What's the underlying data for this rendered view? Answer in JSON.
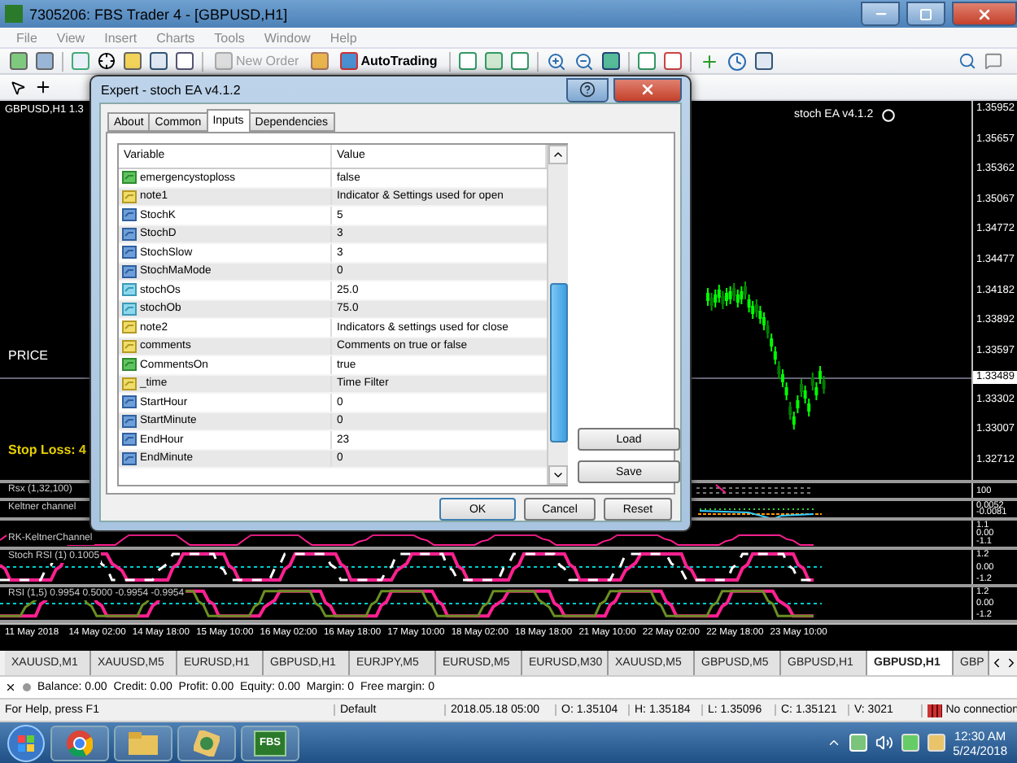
{
  "window": {
    "title": "7305206: FBS Trader 4 - [GBPUSD,H1]"
  },
  "menu": [
    {
      "label": "File",
      "disabled": true
    },
    {
      "label": "View",
      "disabled": true
    },
    {
      "label": "Insert",
      "disabled": true
    },
    {
      "label": "Charts",
      "disabled": true
    },
    {
      "label": "Tools",
      "disabled": true
    },
    {
      "label": "Window",
      "disabled": true
    },
    {
      "label": "Help",
      "disabled": true
    }
  ],
  "toolbar": {
    "new_order": {
      "label": "New Order",
      "disabled": true
    },
    "autotrading": {
      "label": "AutoTrading",
      "disabled": false
    }
  },
  "chart": {
    "label": "GBPUSD,H1 1.3",
    "ea_label": "stoch EA v4.1.2",
    "price_label": "PRICE",
    "stop_loss": "Stop Loss: 4",
    "price_axis": [
      "1.35952",
      "1.35657",
      "1.35362",
      "1.35067",
      "1.34772",
      "1.34477",
      "1.34182",
      "1.33892",
      "1.33597",
      "1.33302",
      "1.33007",
      "1.32712"
    ],
    "current_price": "1.33489",
    "subwindows": [
      {
        "label": "Rsx (1,32,100)",
        "axis": [
          "100"
        ]
      },
      {
        "label": "Keltner channel",
        "axis": [
          "0.0052",
          "-0.0081"
        ]
      },
      {
        "label": "RK-KeltnerChannel",
        "axis": [
          "1.1",
          "0.00",
          "-1.1"
        ]
      },
      {
        "label": "Stoch RSI (1) 0.1005",
        "axis": [
          "1.2",
          "0.00",
          "-1.2"
        ]
      },
      {
        "label": "RSI (1,5) 0.9954 0.5000 -0.9954 -0.9954",
        "axis": [
          "1.2",
          "0.00",
          "-1.2"
        ]
      }
    ],
    "time_axis": [
      "11 May 2018",
      "14 May 02:00",
      "14 May 18:00",
      "15 May 10:00",
      "16 May 02:00",
      "16 May 18:00",
      "17 May 10:00",
      "18 May 02:00",
      "18 May 18:00",
      "21 May 10:00",
      "22 May 02:00",
      "22 May 18:00",
      "23 May 10:00"
    ]
  },
  "dialog": {
    "title": "Expert - stoch EA v4.1.2",
    "tabs": [
      {
        "label": "About",
        "selected": false
      },
      {
        "label": "Common",
        "selected": false
      },
      {
        "label": "Inputs",
        "selected": true
      },
      {
        "label": "Dependencies",
        "selected": false
      }
    ],
    "columns": [
      "Variable",
      "Value"
    ],
    "rows": [
      {
        "kind": "bool",
        "name": "emergencystoploss",
        "value": "false"
      },
      {
        "kind": "string",
        "name": "note1",
        "value": "Indicator & Settings used for open"
      },
      {
        "kind": "int",
        "name": "StochK",
        "value": "5"
      },
      {
        "kind": "int",
        "name": "StochD",
        "value": "3"
      },
      {
        "kind": "int",
        "name": "StochSlow",
        "value": "3"
      },
      {
        "kind": "int",
        "name": "StochMaMode",
        "value": "0"
      },
      {
        "kind": "double",
        "name": "stochOs",
        "value": "25.0"
      },
      {
        "kind": "double",
        "name": "stochOb",
        "value": "75.0"
      },
      {
        "kind": "string",
        "name": "note2",
        "value": "Indicators & settings used for close"
      },
      {
        "kind": "string",
        "name": "comments",
        "value": "Comments on true or false"
      },
      {
        "kind": "bool",
        "name": "CommentsOn",
        "value": "true"
      },
      {
        "kind": "string",
        "name": "_time",
        "value": "Time Filter"
      },
      {
        "kind": "int",
        "name": "StartHour",
        "value": "0"
      },
      {
        "kind": "int",
        "name": "StartMinute",
        "value": "0"
      },
      {
        "kind": "int",
        "name": "EndHour",
        "value": "23"
      },
      {
        "kind": "int",
        "name": "EndMinute",
        "value": "0"
      }
    ],
    "side_buttons": [
      "Load",
      "Save"
    ],
    "buttons": [
      "OK",
      "Cancel",
      "Reset"
    ]
  },
  "symbol_tabs": [
    {
      "label": "XAUUSD,M1",
      "selected": false
    },
    {
      "label": "XAUUSD,M5",
      "selected": false
    },
    {
      "label": "EURUSD,H1",
      "selected": false
    },
    {
      "label": "GBPUSD,H1",
      "selected": false
    },
    {
      "label": "EURJPY,M5",
      "selected": false
    },
    {
      "label": "EURUSD,M5",
      "selected": false
    },
    {
      "label": "EURUSD,M30",
      "selected": false
    },
    {
      "label": "XAUUSD,M5",
      "selected": false
    },
    {
      "label": "GBPUSD,M5",
      "selected": false
    },
    {
      "label": "GBPUSD,H1",
      "selected": false
    },
    {
      "label": "GBPUSD,H1",
      "selected": true
    },
    {
      "label": "GBP",
      "selected": false
    }
  ],
  "account": "Balance: 0.00  Credit: 0.00  Profit: 0.00  Equity: 0.00  Margin: 0  Free margin: 0",
  "status_bar": [
    "For Help, press F1",
    "Default",
    "2018.05.18 05:00",
    "O: 1.35104",
    "H: 1.35184",
    "L: 1.35096",
    "C: 1.35121",
    "V: 3021",
    "No connection"
  ],
  "taskbar": {
    "apps": [
      {
        "kind": "browser"
      },
      {
        "kind": "folder"
      },
      {
        "kind": "game"
      },
      {
        "kind": "fbs",
        "label": "FBS"
      }
    ],
    "time": "12:30 AM",
    "date": "5/24/2018"
  }
}
